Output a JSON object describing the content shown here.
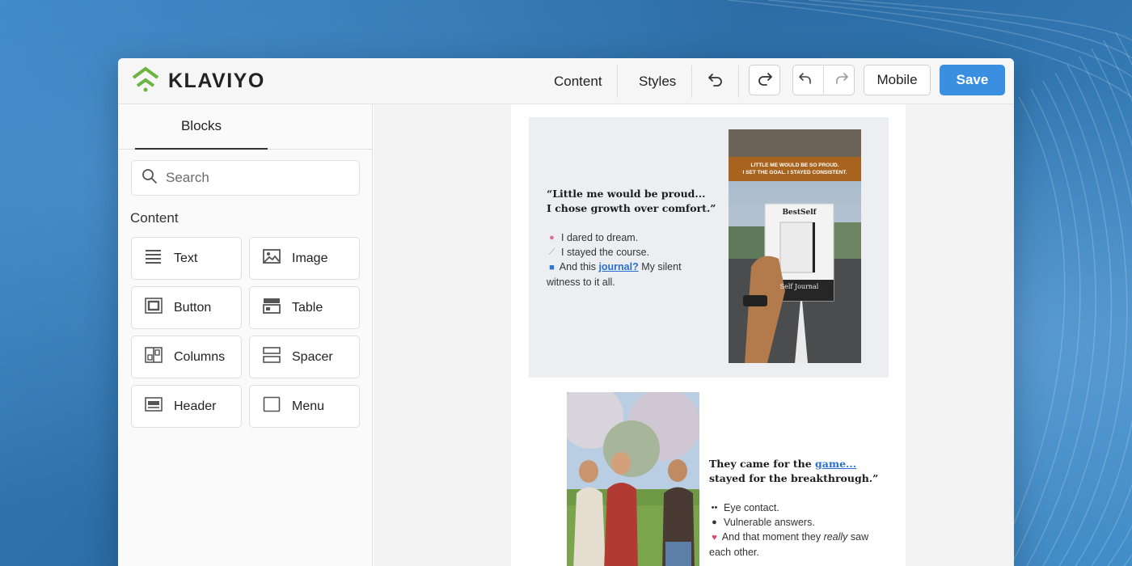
{
  "app": {
    "brand": "KLAVIYO",
    "brand_color": "#6cb33f"
  },
  "toolbar": {
    "content_label": "Content",
    "styles_label": "Styles",
    "mobile_label": "Mobile",
    "save_label": "Save",
    "icons": [
      "undo-icon",
      "redo-icon",
      "undo-small-icon",
      "redo-small-icon"
    ]
  },
  "sidebar": {
    "tab": "Blocks",
    "search_placeholder": "Search",
    "section": "Content",
    "blocks": [
      {
        "label": "Text",
        "icon": "text-lines-icon"
      },
      {
        "label": "Image",
        "icon": "image-icon"
      },
      {
        "label": "Button",
        "icon": "button-icon"
      },
      {
        "label": "Table",
        "icon": "table-icon"
      },
      {
        "label": "Columns",
        "icon": "columns-icon"
      },
      {
        "label": "Spacer",
        "icon": "spacer-icon"
      },
      {
        "label": "Header",
        "icon": "header-icon"
      },
      {
        "label": "Menu",
        "icon": "menu-icon"
      }
    ]
  },
  "email": {
    "block1": {
      "quote_line1": "“Little me would be proud...",
      "quote_line2": "I chose growth over comfort.”",
      "b1": "I dared to dream.",
      "b2": "I stayed the course.",
      "b3_pre": "And this ",
      "b3_link": "journal?",
      "b3_post": " My silent",
      "b3_cont": "witness to it all.",
      "photo_caption1": "LITTLE ME WOULD BE SO PROUD.",
      "photo_caption2": "I SET THE GOAL. I STAYED CONSISTENT.",
      "book_title": "BestSelf",
      "book_sub": "Self Journal"
    },
    "block2": {
      "quote_pre": "They came for the ",
      "quote_link": "game...",
      "quote_line2": "stayed for the breakthrough.”",
      "b1": "Eye contact.",
      "b2": "Vulnerable answers.",
      "b3_pre": "And that moment they ",
      "b3_em": "really",
      "b3_post": " saw",
      "b3_cont": "each other."
    }
  }
}
